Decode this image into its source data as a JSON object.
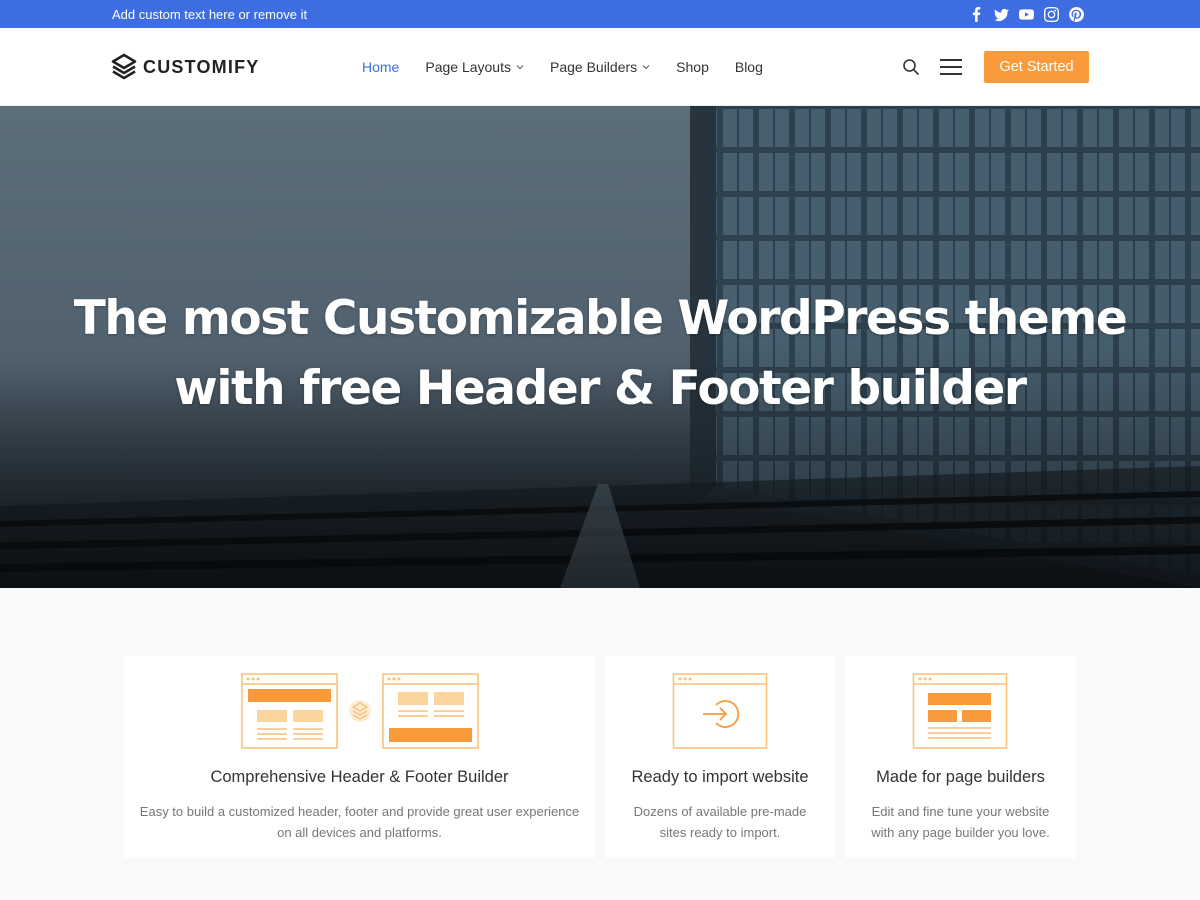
{
  "topbar": {
    "text": "Add custom text here or remove it",
    "social": [
      "facebook-icon",
      "twitter-icon",
      "youtube-icon",
      "instagram-icon",
      "pinterest-icon"
    ],
    "bg_color": "#3d6de0"
  },
  "header": {
    "brand": "CUSTOMIFY",
    "nav": [
      {
        "label": "Home",
        "active": true
      },
      {
        "label": "Page Layouts",
        "dropdown": true
      },
      {
        "label": "Page Builders",
        "dropdown": true
      },
      {
        "label": "Shop"
      },
      {
        "label": "Blog"
      }
    ],
    "cta_label": "Get Started",
    "accent_color": "#3d6de0",
    "cta_color": "#fb9a3a"
  },
  "hero": {
    "title_line1": "The most Customizable WordPress theme",
    "title_line2": "with free Header & Footer builder"
  },
  "features": [
    {
      "title": "Comprehensive Header & Footer Builder",
      "description": "Easy to build a customized header, footer and provide great user experience on all devices and platforms.",
      "icon": "header-footer-builder-icon"
    },
    {
      "title": "Ready to import website",
      "description": "Dozens of available pre-made sites ready to import.",
      "icon": "import-website-icon"
    },
    {
      "title": "Made for page builders",
      "description": "Edit and fine tune your website with any page builder you love.",
      "icon": "page-builder-icon"
    }
  ]
}
